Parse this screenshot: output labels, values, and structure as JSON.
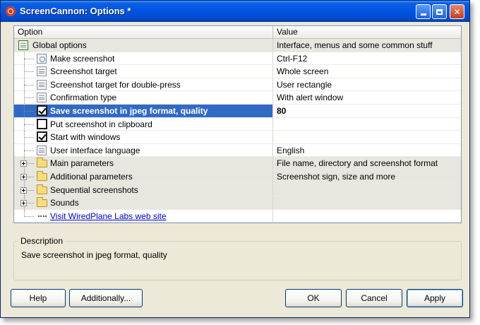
{
  "window": {
    "title": "ScreenCannon: Options *"
  },
  "grid": {
    "columns": {
      "option": "Option",
      "value": "Value"
    },
    "rows": [
      {
        "label": "Global options",
        "value": "Interface, menus and some common stuff",
        "icon": "checklist-icon"
      },
      {
        "label": "Make screenshot",
        "value": "Ctrl-F12",
        "icon": "gear-icon"
      },
      {
        "label": "Screenshot target",
        "value": "Whole screen",
        "icon": "property-icon"
      },
      {
        "label": "Screenshot target for double-press",
        "value": "User rectangle",
        "icon": "property-icon"
      },
      {
        "label": "Confirmation type",
        "value": "With alert window",
        "icon": "property-icon"
      },
      {
        "label": "Save screenshot in jpeg format, quality",
        "value": "80",
        "icon": "checkbox-checked-icon"
      },
      {
        "label": "Put screenshot in clipboard",
        "value": "",
        "icon": "checkbox-unchecked-icon"
      },
      {
        "label": "Start with windows",
        "value": "",
        "icon": "checkbox-checked-icon"
      },
      {
        "label": "User interface language",
        "value": "English",
        "icon": "property-icon"
      },
      {
        "label": "Main parameters",
        "value": "File name, directory and screenshot format",
        "icon": "folder-icon"
      },
      {
        "label": "Additional parameters",
        "value": "Screenshot sign, size and more",
        "icon": "folder-icon"
      },
      {
        "label": "Sequential screenshots",
        "value": "",
        "icon": "folder-icon"
      },
      {
        "label": "Sounds",
        "value": "",
        "icon": "folder-icon"
      },
      {
        "label": "Visit WiredPlane Labs web site",
        "value": "",
        "icon": "link-dots-icon"
      }
    ]
  },
  "description": {
    "legend": "Description",
    "text": "Save screenshot in jpeg format, quality"
  },
  "buttons": {
    "help": "Help",
    "additionally": "Additionally...",
    "ok": "OK",
    "cancel": "Cancel",
    "apply": "Apply"
  },
  "colors": {
    "selection": "#316ac5",
    "link": "#0000cc",
    "titlebar": "#0054e3"
  }
}
